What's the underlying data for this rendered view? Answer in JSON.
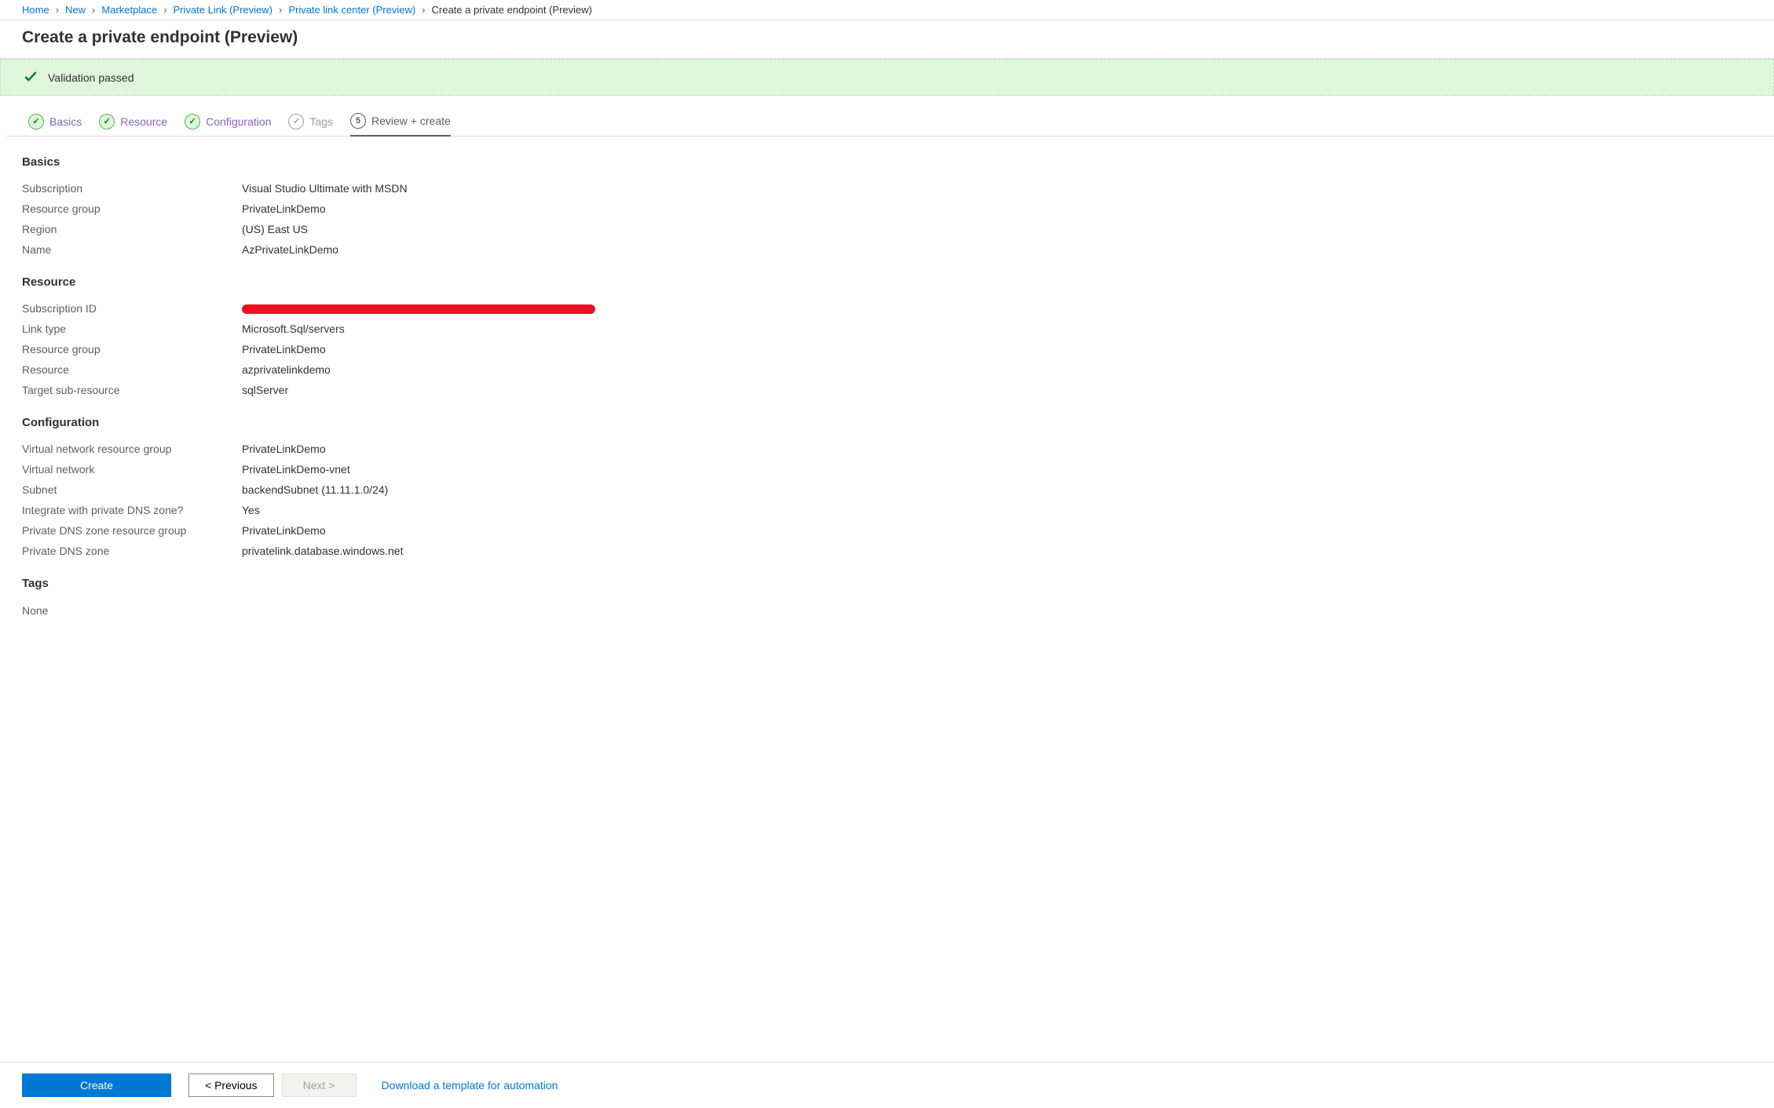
{
  "breadcrumb": {
    "items": [
      {
        "label": "Home",
        "link": true
      },
      {
        "label": "New",
        "link": true
      },
      {
        "label": "Marketplace",
        "link": true
      },
      {
        "label": "Private Link (Preview)",
        "link": true
      },
      {
        "label": "Private link center (Preview)",
        "link": true
      },
      {
        "label": "Create a private endpoint (Preview)",
        "link": false
      }
    ]
  },
  "page_title": "Create a private endpoint (Preview)",
  "validation": {
    "message": "Validation passed"
  },
  "tabs": [
    {
      "label": "Basics",
      "state": "completed",
      "indicator": "✓"
    },
    {
      "label": "Resource",
      "state": "completed",
      "indicator": "✓"
    },
    {
      "label": "Configuration",
      "state": "completed",
      "indicator": "✓"
    },
    {
      "label": "Tags",
      "state": "disabled",
      "indicator": "✓"
    },
    {
      "label": "Review + create",
      "state": "current",
      "indicator": "5"
    }
  ],
  "sections": {
    "basics": {
      "heading": "Basics",
      "rows": [
        {
          "key": "Subscription",
          "val": "Visual Studio Ultimate with MSDN"
        },
        {
          "key": "Resource group",
          "val": "PrivateLinkDemo"
        },
        {
          "key": "Region",
          "val": "(US) East US"
        },
        {
          "key": "Name",
          "val": "AzPrivateLinkDemo"
        }
      ]
    },
    "resource": {
      "heading": "Resource",
      "rows": [
        {
          "key": "Subscription ID",
          "val": "",
          "redacted": true
        },
        {
          "key": "Link type",
          "val": "Microsoft.Sql/servers"
        },
        {
          "key": "Resource group",
          "val": "PrivateLinkDemo"
        },
        {
          "key": "Resource",
          "val": "azprivatelinkdemo"
        },
        {
          "key": "Target sub-resource",
          "val": "sqlServer"
        }
      ]
    },
    "configuration": {
      "heading": "Configuration",
      "rows": [
        {
          "key": "Virtual network resource group",
          "val": "PrivateLinkDemo"
        },
        {
          "key": "Virtual network",
          "val": "PrivateLinkDemo-vnet"
        },
        {
          "key": "Subnet",
          "val": "backendSubnet (11.11.1.0/24)"
        },
        {
          "key": "Integrate with private DNS zone?",
          "val": "Yes"
        },
        {
          "key": "Private DNS zone resource group",
          "val": "PrivateLinkDemo"
        },
        {
          "key": "Private DNS zone",
          "val": "privatelink.database.windows.net"
        }
      ]
    },
    "tags": {
      "heading": "Tags",
      "none_label": "None"
    }
  },
  "footer": {
    "create": "Create",
    "previous": "< Previous",
    "next": "Next >",
    "download": "Download a template for automation"
  }
}
